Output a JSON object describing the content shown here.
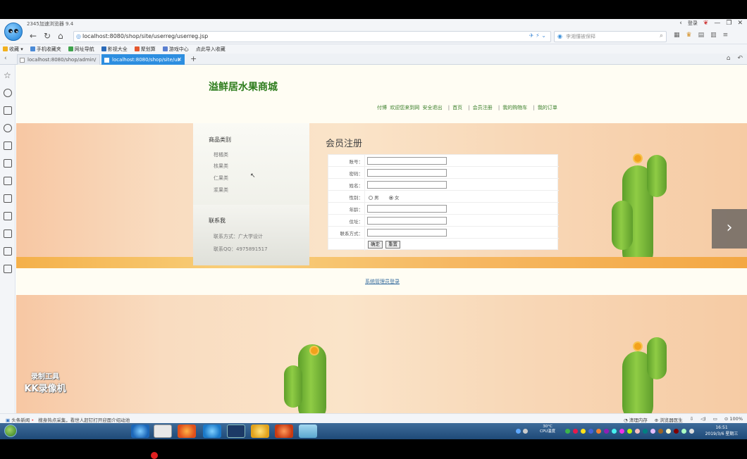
{
  "browser": {
    "name": "2345加速浏览器 9.4",
    "url": "localhost:8080/shop/site/userreg/userreg.jsp",
    "search_placeholder": "李湘懂被保释",
    "tabs": [
      {
        "label": "localhost:8080/shop/admin/",
        "active": false
      },
      {
        "label": "localhost:8080/shop/site/us",
        "active": true
      }
    ],
    "bookmarks": [
      "收藏",
      "手机收藏夹",
      "网址导航",
      "影视大全",
      "聚划算",
      "游戏中心",
      "点此导入收藏"
    ],
    "window_text": "登录"
  },
  "site": {
    "title": "溢鲜居水果商城",
    "nav": {
      "user": "付博",
      "welcome": "欢迎您来到网",
      "logout": "安全退出",
      "items": [
        "首页",
        "会员注册",
        "我的购物车",
        "我的订单"
      ]
    },
    "category": {
      "heading": "商品类别",
      "items": [
        "柑橘类",
        "核果类",
        "仁果类",
        "浆果类"
      ]
    },
    "contact": {
      "heading": "联系我",
      "lines": [
        "联系方式：广大学设计",
        "联系QQ：4975891517"
      ]
    },
    "form": {
      "title": "会员注册",
      "fields": [
        {
          "label": "账号："
        },
        {
          "label": "密码："
        },
        {
          "label": "姓名："
        }
      ],
      "gender": {
        "label": "性别：",
        "options": [
          "男",
          "女"
        ],
        "selected": "女"
      },
      "fields2": [
        {
          "label": "年龄："
        },
        {
          "label": "住址："
        },
        {
          "label": "联系方式："
        }
      ],
      "submit": "确定",
      "reset": "重置"
    },
    "footer_link": "系统管理员登录",
    "next_arrow": "›"
  },
  "watermark": {
    "line1": "录制工具",
    "line2": "KK录像机"
  },
  "statusbar": {
    "left_label": "头条新闻",
    "left_text": "搜身热点采集，看世人赶钉打开迎面介绍动池",
    "right": [
      "清理内存",
      "浏览器医生",
      "100%"
    ]
  },
  "taskbar": {
    "cpu_line1": "30°C",
    "cpu_line2": "CPU温度",
    "time": "16:51",
    "date": "2019/3/6 星期三"
  },
  "colors": {
    "site_green": "#2e7d1e",
    "tab_active": "#2d8ee0"
  }
}
